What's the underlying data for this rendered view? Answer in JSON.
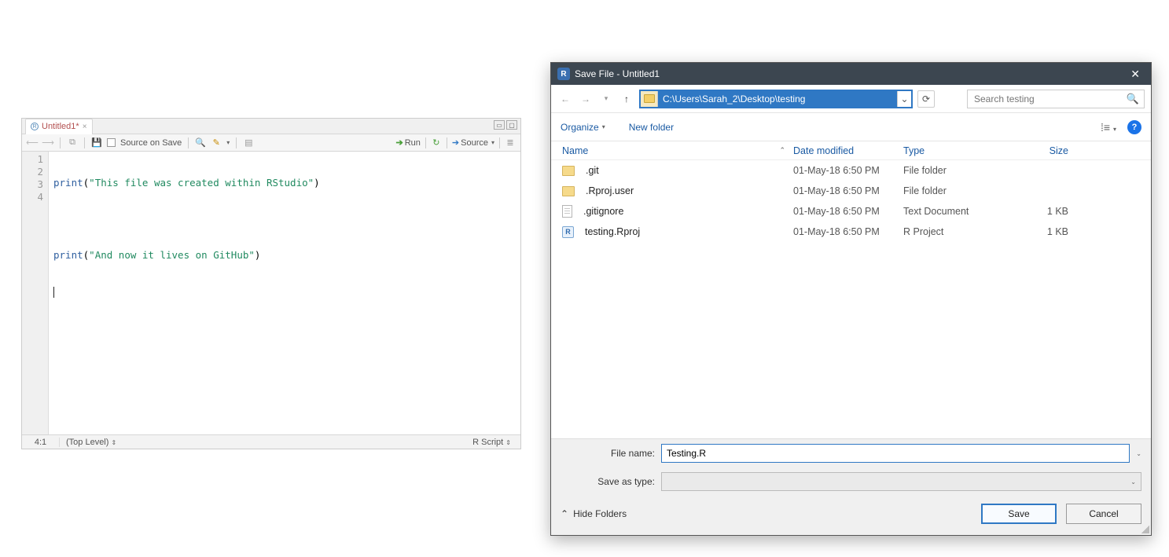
{
  "editor": {
    "tab": {
      "label": "Untitled1*",
      "iconLetter": "R"
    },
    "toolbar": {
      "sourceOnSave": "Source on Save",
      "run": "Run",
      "source": "Source"
    },
    "lines": [
      "1",
      "2",
      "3",
      "4"
    ],
    "code": {
      "line1_kw": "print",
      "line1_p1": "(",
      "line1_str": "\"This file was created within RStudio\"",
      "line1_p2": ")",
      "line3_kw": "print",
      "line3_p1": "(",
      "line3_str": "\"And now it lives on GitHub\"",
      "line3_p2": ")"
    },
    "status": {
      "pos": "4:1",
      "scope": "(Top Level) ",
      "lang": "R Script "
    }
  },
  "dialog": {
    "title": "Save File - Untitled1",
    "appBadge": "R",
    "path": "C:\\Users\\Sarah_2\\Desktop\\testing",
    "searchPlaceholder": "Search testing",
    "organize": "Organize",
    "newFolder": "New folder",
    "columns": {
      "name": "Name",
      "date": "Date modified",
      "type": "Type",
      "size": "Size"
    },
    "files": [
      {
        "icon": "folder",
        "name": ".git",
        "date": "01-May-18 6:50 PM",
        "type": "File folder",
        "size": ""
      },
      {
        "icon": "folder",
        "name": ".Rproj.user",
        "date": "01-May-18 6:50 PM",
        "type": "File folder",
        "size": ""
      },
      {
        "icon": "file",
        "name": ".gitignore",
        "date": "01-May-18 6:50 PM",
        "type": "Text Document",
        "size": "1 KB"
      },
      {
        "icon": "rproj",
        "name": "testing.Rproj",
        "date": "01-May-18 6:50 PM",
        "type": "R Project",
        "size": "1 KB"
      }
    ],
    "fileNameLabel": "File name:",
    "fileNameValue": "Testing.R",
    "saveAsTypeLabel": "Save as type:",
    "saveAsTypeValue": "",
    "hideFolders": "Hide Folders",
    "save": "Save",
    "cancel": "Cancel",
    "helpBadge": "?"
  }
}
